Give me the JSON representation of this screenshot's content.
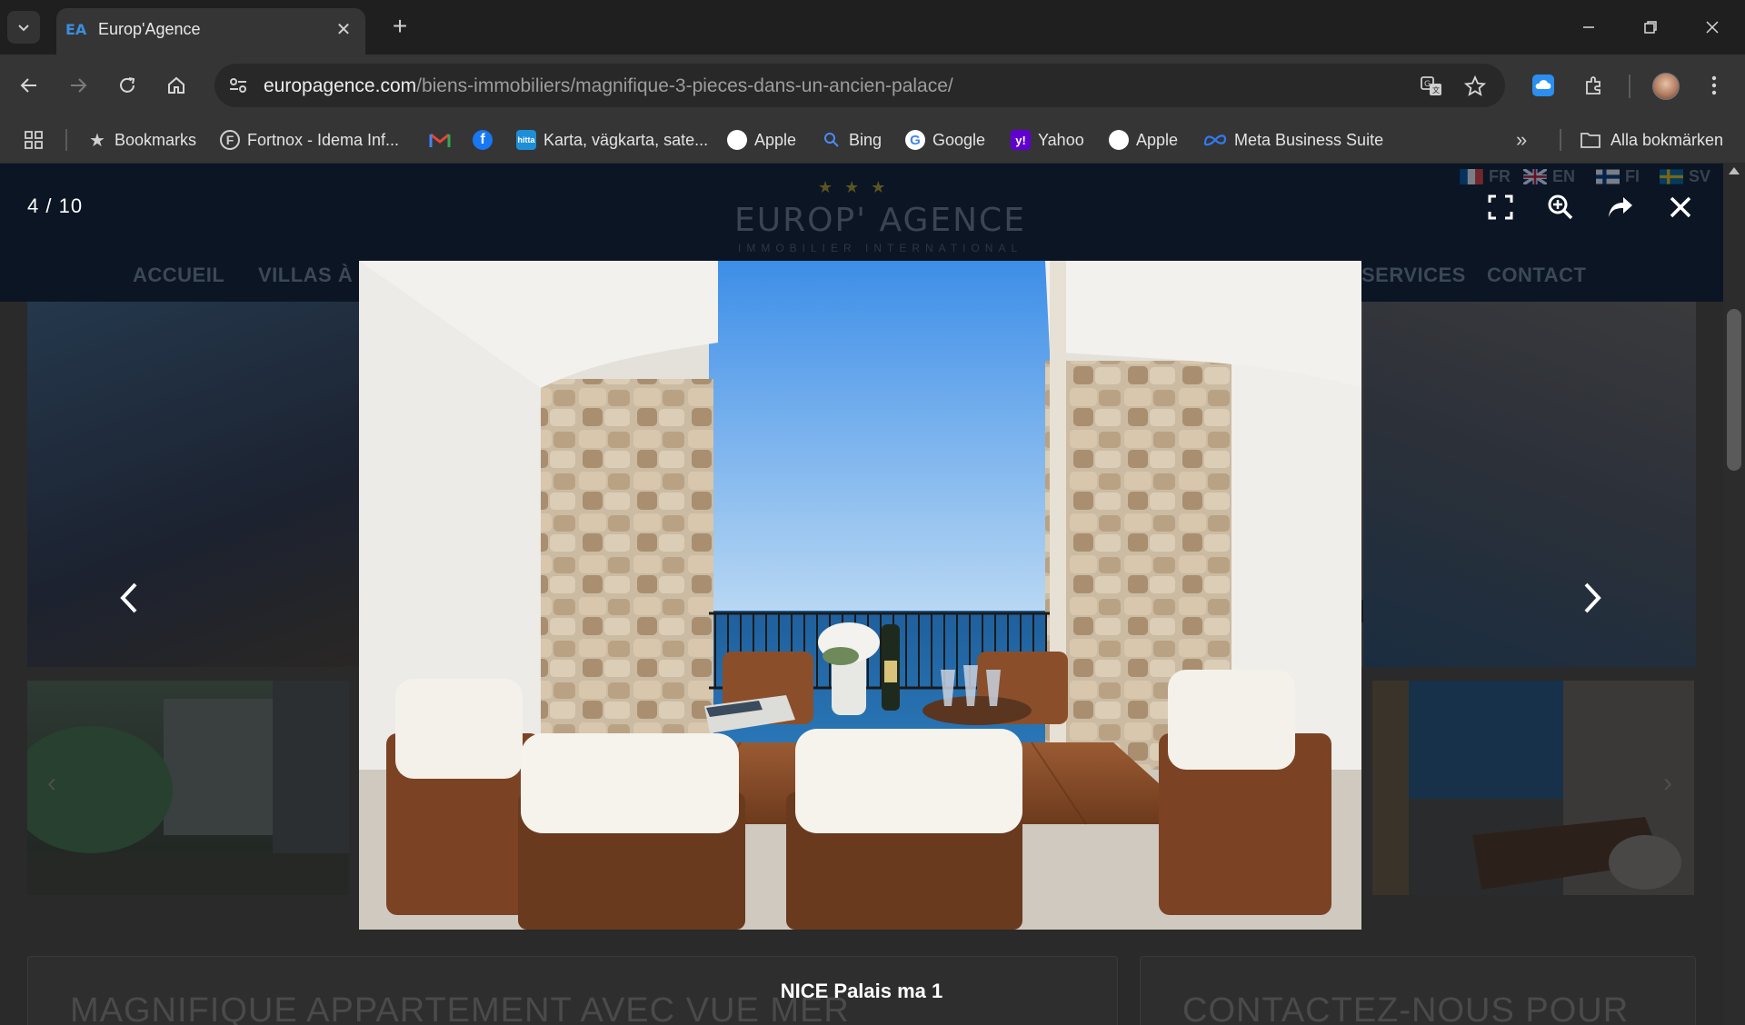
{
  "browser": {
    "tab": {
      "favicon_text": "EA",
      "title": "Europ'Agence"
    },
    "url_host": "europagence.com",
    "url_path": "/biens-immobiliers/magnifique-3-pieces-dans-un-ancien-palace/",
    "bookmarks": [
      {
        "label": "Bookmarks",
        "icon": "star-icon"
      },
      {
        "label": "Fortnox - Idema Inf...",
        "icon": "fortnox-icon"
      },
      {
        "label": "",
        "icon": "gmail-icon"
      },
      {
        "label": "",
        "icon": "facebook-icon"
      },
      {
        "label": "Karta, vägkarta, sate...",
        "icon": "hitta-icon"
      },
      {
        "label": "Apple",
        "icon": "apple-icon"
      },
      {
        "label": "Bing",
        "icon": "bing-icon"
      },
      {
        "label": "Google",
        "icon": "google-icon"
      },
      {
        "label": "Yahoo",
        "icon": "yahoo-icon"
      },
      {
        "label": "Apple",
        "icon": "apple-icon"
      },
      {
        "label": "Meta Business Suite",
        "icon": "meta-icon"
      }
    ],
    "all_bookmarks": "Alla bokmärken"
  },
  "site": {
    "languages": [
      "FR",
      "EN",
      "FI",
      "SV"
    ],
    "logo": {
      "name": "EUROP' AGENCE",
      "tagline": "IMMOBILIER INTERNATIONAL",
      "stars": "★ ★ ★"
    },
    "menu": {
      "left1": "ACCUEIL",
      "left2": "VILLAS À V",
      "right1": "SERVICES",
      "right2": "CONTACT"
    },
    "card_left_title": "MAGNIFIQUE APPARTEMENT AVEC VUE MER",
    "card_right_title": "CONTACTEZ-NOUS POUR"
  },
  "lightbox": {
    "counter_current": "4",
    "counter_separator": "/",
    "counter_total": "10",
    "caption": "NICE Palais ma 1",
    "progress": {
      "current": 4,
      "total": 10
    }
  },
  "colors": {
    "site_header": "#0b1524",
    "chrome_bg": "#1f1f1f",
    "toolbar_bg": "#353535",
    "accent_blue": "#3b8de0"
  }
}
